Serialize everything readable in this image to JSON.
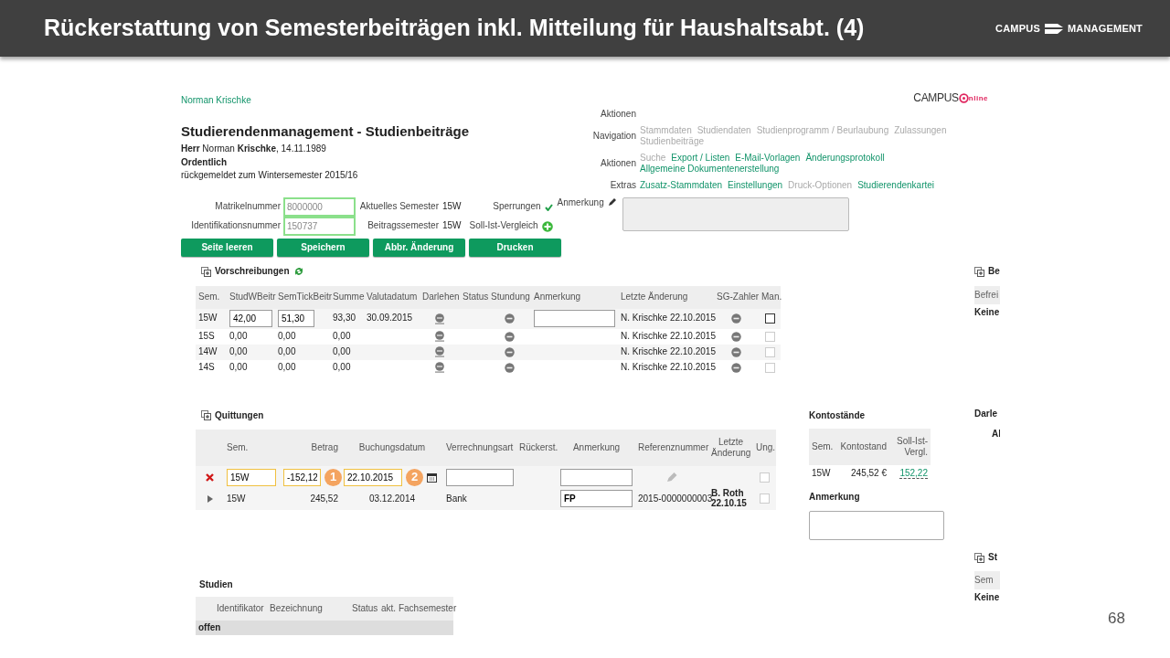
{
  "slide": {
    "title": "Rückerstattung von Semesterbeiträgen inkl. Mitteilung für Haushaltsabt. (4)",
    "logo": [
      "CAMPUS",
      "MANAGEMENT"
    ],
    "page_number": "68"
  },
  "app": {
    "user_link": "Norman Krischke",
    "app_logo": {
      "left": "CAMPUS",
      "right": "nline"
    },
    "heading": "Studierendenmanagement - Studienbeiträge",
    "person_line": "**Herr** Norman **Krischke**, 14.11.1989",
    "status": "Ordentlich",
    "registration": "rückgemeldet zum Wintersemester 2015/16",
    "nav": [
      {
        "label": "Aktionen"
      },
      {
        "label": "Navigation",
        "links": [
          {
            "text": "Stammdaten",
            "enabled": false
          },
          {
            "text": "Studiendaten",
            "enabled": false
          },
          {
            "text": "Studienprogramm / Beurlaubung",
            "enabled": false
          },
          {
            "text": "Zulassungen",
            "enabled": false
          },
          {
            "text": "Studienbeiträge",
            "enabled": false
          }
        ]
      },
      {
        "label": "Aktionen",
        "links": [
          {
            "text": "Suche",
            "enabled": false
          },
          {
            "text": "Export / Listen",
            "enabled": true
          },
          {
            "text": "E-Mail-Vorlagen",
            "enabled": true
          },
          {
            "text": "Änderungsprotokoll",
            "enabled": true
          },
          {
            "text": "Allgemeine Dokumentenerstellung",
            "enabled": true
          }
        ]
      },
      {
        "label": "Extras",
        "links": [
          {
            "text": "Zusatz-Stammdaten",
            "enabled": true
          },
          {
            "text": "Einstellungen",
            "enabled": true
          },
          {
            "text": "Druck-Optionen",
            "enabled": false
          },
          {
            "text": "Studierendenkartei",
            "enabled": true
          }
        ]
      }
    ],
    "fields": [
      {
        "label": "Matrikelnummer",
        "value": "8000000",
        "info_label": "Aktuelles Semester",
        "info_value": "15W"
      },
      {
        "label": "Identifikationsnummer",
        "value": "150737",
        "info_label": "Beitragssemester",
        "info_value": "15W"
      }
    ],
    "sperrungen": {
      "label": "Sperrungen",
      "ok": true
    },
    "soll_ist": {
      "label": "Soll-Ist-Vergleich"
    },
    "remark_label": "Anmerkung",
    "buttons": [
      "Seite leeren",
      "Speichern",
      "Abbr. Änderung",
      "Drucken"
    ],
    "vorschreibungen": {
      "title": "Vorschreibungen",
      "columns": [
        "Sem.",
        "StudWBeitr",
        "SemTickBeitr",
        "Summe",
        "Valutadatum",
        "Darlehen",
        "Status",
        "Stundung",
        "Anmerkung",
        "Letzte Änderung",
        "SG-Zahler",
        "Man."
      ],
      "rows": [
        {
          "kind": "edit",
          "sem": "15W",
          "stud": "42,00",
          "tick": "51,30",
          "summe": "93,30",
          "valuta": "30.09.2015",
          "changed": "N. Krischke 22.10.2015",
          "checked": false
        },
        {
          "kind": "view",
          "sem": "15S",
          "stud": "0,00",
          "tick": "0,00",
          "summe": "0,00",
          "changed": "N. Krischke 22.10.2015",
          "checked": false
        },
        {
          "kind": "view",
          "sem": "14W",
          "stud": "0,00",
          "tick": "0,00",
          "summe": "0,00",
          "changed": "N. Krischke 22.10.2015",
          "checked": false
        },
        {
          "kind": "view",
          "sem": "14S",
          "stud": "0,00",
          "tick": "0,00",
          "summe": "0,00",
          "changed": "N. Krischke 22.10.2015",
          "checked": false
        }
      ]
    },
    "quittungen": {
      "title": "Quittungen",
      "columns": [
        "Sem.",
        "Betrag",
        "Buchungsdatum",
        "Verrechnungsart",
        "Rückerst.",
        "Anmerkung",
        "Referenznummer",
        "Letzte Änderung",
        "Ung."
      ],
      "markers": [
        "1",
        "2"
      ],
      "rows": [
        {
          "kind": "new",
          "sem": "15W",
          "betrag": "-152,12",
          "datum": "22.10.2015",
          "checked": false
        },
        {
          "kind": "entry",
          "sem": "15W",
          "betrag": "245,52",
          "datum": "03.12.2014",
          "verrechnungsart": "Bank",
          "anmerkung": "FP",
          "referenz": "2015-0000000003",
          "changed": "B. Roth 22.10.15",
          "checked": false
        }
      ]
    },
    "kontostaende": {
      "title": "Kontostände",
      "columns": [
        "Sem.",
        "Kontostand",
        "Soll-Ist-Vergl."
      ],
      "rows": [
        {
          "sem": "15W",
          "stand": "245,52 €",
          "vergleich": "152,22"
        }
      ],
      "remark_label": "Anmerkung"
    },
    "studien": {
      "title": "Studien",
      "columns": [
        "Identifikator",
        "Bezeichnung",
        "Status",
        "akt. Fachsemester"
      ],
      "group": "offen"
    },
    "right_column": {
      "section1_title": "Be",
      "section1_header": "Befrei",
      "section1_row": "Keine",
      "section2_title": "Darle",
      "section2_row": "Al",
      "section3_title": "St",
      "section3_header": "Sem",
      "section3_row": "Keine"
    }
  }
}
